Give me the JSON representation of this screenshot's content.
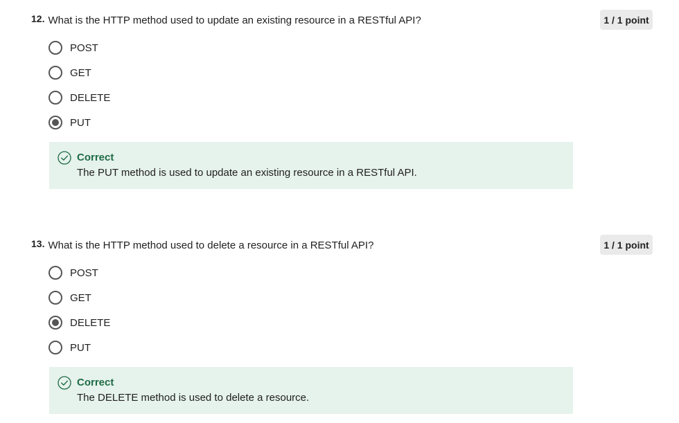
{
  "questions": [
    {
      "number": "12.",
      "text": "What is the HTTP method used to update an existing resource in a RESTful API?",
      "score": "1 / 1 point",
      "options": [
        {
          "label": "POST",
          "selected": false
        },
        {
          "label": "GET",
          "selected": false
        },
        {
          "label": "DELETE",
          "selected": false
        },
        {
          "label": "PUT",
          "selected": true
        }
      ],
      "feedback": {
        "title": "Correct",
        "text": "The PUT method is used to update an existing resource in a RESTful API."
      }
    },
    {
      "number": "13.",
      "text": "What is the HTTP method used to delete a resource in a RESTful API?",
      "score": "1 / 1 point",
      "options": [
        {
          "label": "POST",
          "selected": false
        },
        {
          "label": "GET",
          "selected": false
        },
        {
          "label": "DELETE",
          "selected": true
        },
        {
          "label": "PUT",
          "selected": false
        }
      ],
      "feedback": {
        "title": "Correct",
        "text": "The DELETE method is used to delete a resource."
      }
    }
  ],
  "colors": {
    "feedback_background": "#e6f2ec",
    "correct_green": "#1e6b45",
    "badge_background": "#eaeaea",
    "radio_border": "#555555"
  },
  "icons": {
    "correct": "check-circle-icon"
  }
}
